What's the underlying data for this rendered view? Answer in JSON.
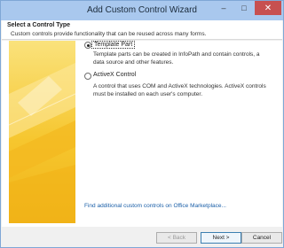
{
  "window": {
    "title": "Add Custom Control Wizard"
  },
  "header": {
    "title": "Select a Control Type",
    "description": "Custom controls provide functionality that can be reused across many forms."
  },
  "options": [
    {
      "label": "Template Part",
      "selected": true,
      "description": "Template parts can be created in InfoPath and contain controls, a data source and other features."
    },
    {
      "label": "ActiveX Control",
      "selected": false,
      "description": "A control that uses COM and ActiveX technologies. ActiveX controls must be installed on each user's computer."
    }
  ],
  "link": {
    "text": "Find additional custom controls on Office Marketplace..."
  },
  "buttons": {
    "back": "< Back",
    "next": "Next >",
    "cancel": "Cancel"
  },
  "colors": {
    "titlebar": "#a9c8ee",
    "sidebar": "#f6c62e",
    "link": "#1a5fa8"
  }
}
